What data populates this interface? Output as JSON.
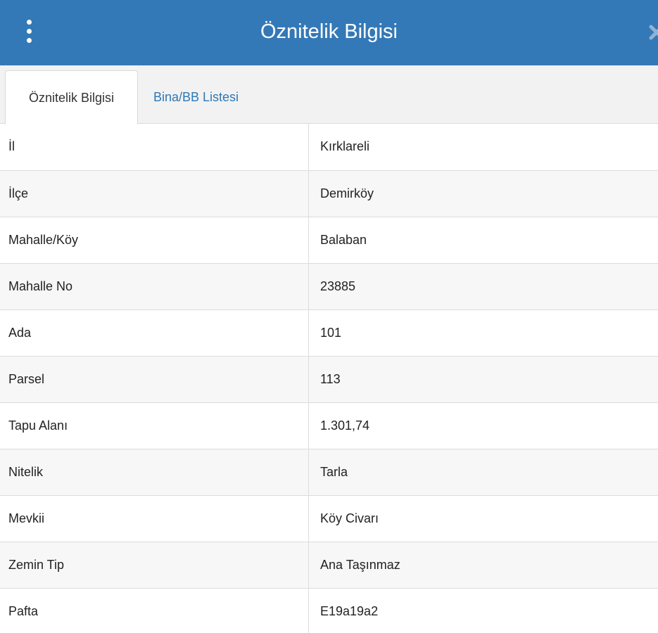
{
  "header": {
    "title": "Öznitelik Bilgisi",
    "menu_icon": "vertical-dots-icon",
    "close_icon": "close-icon",
    "background_color": "#3479b7"
  },
  "tabs": [
    {
      "label": "Öznitelik Bilgisi",
      "active": true
    },
    {
      "label": "Bina/BB Listesi",
      "active": false
    }
  ],
  "table": {
    "rows": [
      {
        "label": "İl",
        "value": "Kırklareli"
      },
      {
        "label": "İlçe",
        "value": "Demirköy"
      },
      {
        "label": "Mahalle/Köy",
        "value": "Balaban"
      },
      {
        "label": "Mahalle No",
        "value": "23885"
      },
      {
        "label": "Ada",
        "value": "101"
      },
      {
        "label": "Parsel",
        "value": "113"
      },
      {
        "label": "Tapu Alanı",
        "value": "1.301,74"
      },
      {
        "label": "Nitelik",
        "value": "Tarla"
      },
      {
        "label": "Mevkii",
        "value": "Köy Civarı"
      },
      {
        "label": "Zemin Tip",
        "value": "Ana Taşınmaz"
      },
      {
        "label": "Pafta",
        "value": "E19a19a2"
      }
    ]
  }
}
